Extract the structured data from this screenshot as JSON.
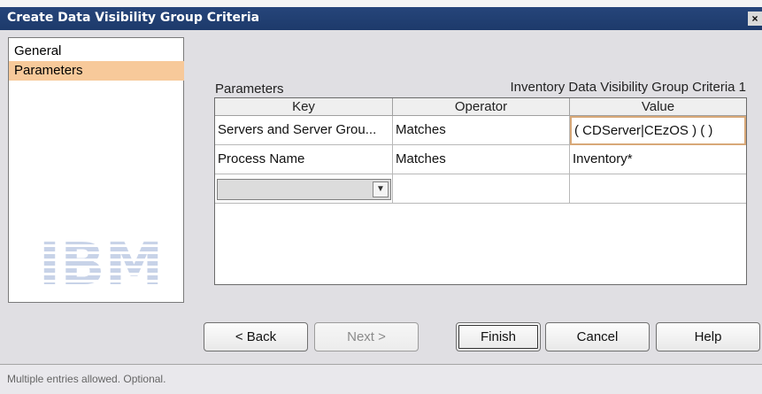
{
  "window": {
    "title": "Create Data Visibility Group Criteria",
    "close_glyph": "×"
  },
  "nav": {
    "items": [
      {
        "label": "General",
        "selected": false
      },
      {
        "label": "Parameters",
        "selected": true
      }
    ],
    "logo_text": "IBM"
  },
  "main": {
    "section_title": "Parameters",
    "criteria_name": "Inventory Data Visibility Group Criteria 1"
  },
  "table": {
    "headers": [
      "Key",
      "Operator",
      "Value"
    ],
    "rows": [
      {
        "key": "Servers and Server Grou...",
        "operator": "Matches",
        "value": "( CDServer|CEzOS ) ( )"
      },
      {
        "key": "Process Name",
        "operator": "Matches",
        "value": "Inventory*"
      },
      {
        "key": "",
        "operator": "",
        "value": ""
      }
    ]
  },
  "buttons": {
    "back": "< Back",
    "next": "Next >",
    "finish": "Finish",
    "cancel": "Cancel",
    "help": "Help"
  },
  "status": {
    "text": "Multiple entries allowed. Optional."
  },
  "colors": {
    "title_bar": "#1d3a6b",
    "selected_nav": "#f7c99a",
    "logo": "#c8d3e8"
  }
}
